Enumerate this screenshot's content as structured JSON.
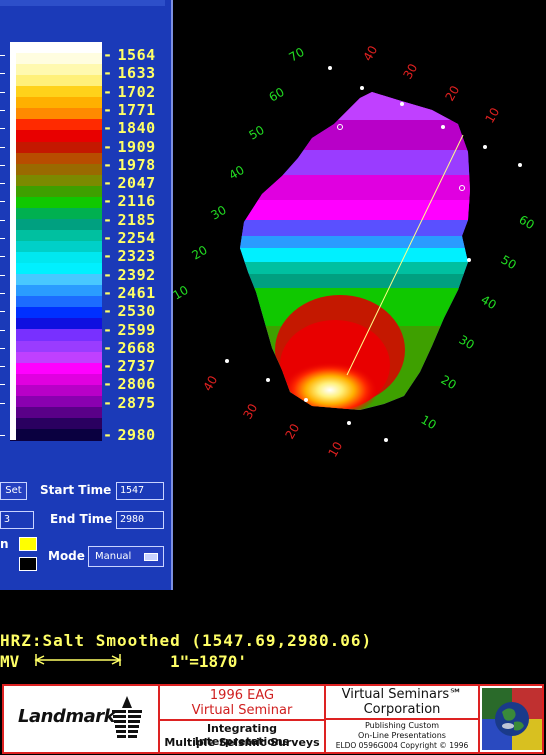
{
  "colorbar": {
    "colors": [
      "#ffffff",
      "#fffde0",
      "#fff9b0",
      "#fff07a",
      "#ffd21a",
      "#ffb000",
      "#ff8a00",
      "#ff2a00",
      "#e80000",
      "#c41800",
      "#b84d00",
      "#9a6a00",
      "#7c8a00",
      "#3ea000",
      "#10c800",
      "#00b050",
      "#00a080",
      "#00c0a0",
      "#00d0c8",
      "#00e8f0",
      "#00f0ff",
      "#48c8ff",
      "#2a9cff",
      "#1c6cff",
      "#0030ff",
      "#1010e0",
      "#7830ff",
      "#9a3cff",
      "#c040ff",
      "#ff00ff",
      "#e000e0",
      "#b800c8",
      "#8a00b0",
      "#5a0088",
      "#2a0060",
      "#0a0040"
    ],
    "labels": [
      "1564",
      "1633",
      "1702",
      "1771",
      "1840",
      "1909",
      "1978",
      "2047",
      "2116",
      "2185",
      "2254",
      "2323",
      "2392",
      "2461",
      "2530",
      "2599",
      "2668",
      "2737",
      "2806",
      "2875",
      "2980"
    ]
  },
  "panel": {
    "set_label": "Set",
    "start_time_label": "Start Time",
    "start_time_value": "1547",
    "left_value": "3",
    "end_time_label": "End Time",
    "end_time_value": "2980",
    "row3_label": "n",
    "mode_label": "Mode",
    "mode_value": "Manual",
    "chip_colors": [
      "#ffff00",
      "#000000"
    ]
  },
  "map": {
    "axis_labels_red": [
      "70",
      "40",
      "30",
      "20",
      "10",
      "40",
      "30",
      "20",
      "10"
    ],
    "axis_labels_green": [
      "60",
      "50",
      "40",
      "30",
      "20",
      "10",
      "60",
      "50",
      "40",
      "30",
      "20",
      "10"
    ]
  },
  "status": {
    "hrz_line": "HRZ:Salt Smoothed (1547.69,2980.06)",
    "mv_label": "MV",
    "scale_label": "1\"=1870'"
  },
  "footer": {
    "company": "Landmark",
    "event_line1": "1996 EAG",
    "event_line2": "Virtual Seminar",
    "title_line1": "Integrating Interpretations",
    "title_line2": "Multiple Seismic Surveys",
    "vs_line1": "Virtual Seminars℠",
    "vs_line2": "Corporation",
    "vs_small1": "Publishing Custom",
    "vs_small2": "On-Line Presentations",
    "vs_copyright": "ELDO 0596G004 Copyright © 1996",
    "logo_colors": [
      "#2a6a2a",
      "#c03030",
      "#2a4ac0",
      "#d8c020"
    ]
  }
}
